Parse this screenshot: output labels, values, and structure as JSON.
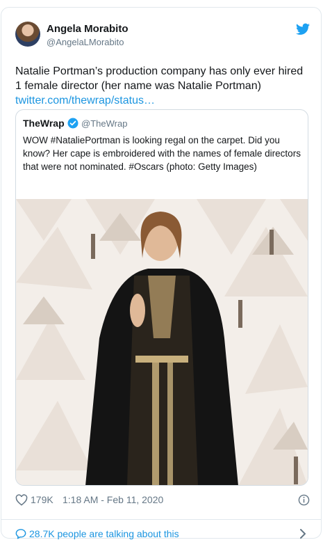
{
  "author": {
    "name": "Angela Morabito",
    "handle": "@AngelaLMorabito"
  },
  "tweet": {
    "text": "Natalie Portman’s production company has only ever hired 1 female director (her name was Natalie Portman)",
    "link": "twitter.com/thewrap/status…"
  },
  "quoted": {
    "name": "TheWrap",
    "handle": "@TheWrap",
    "text": "WOW #NataliePortman is looking regal on the carpet. Did you know? Her cape is embroidered with the names of female directors that were not nominated. #Oscars (photo: Getty Images)"
  },
  "stats": {
    "likes": "179K",
    "timestamp": "1:18 AM - Feb 11, 2020"
  },
  "footer": {
    "talking": "28.7K people are talking about this"
  },
  "colors": {
    "accent": "#1b95e0",
    "verified": "#1da1f2",
    "muted": "#657786"
  },
  "icons": [
    "twitter-bird-icon",
    "verified-badge-icon",
    "heart-icon",
    "info-icon",
    "speech-bubble-icon",
    "chevron-right-icon"
  ]
}
